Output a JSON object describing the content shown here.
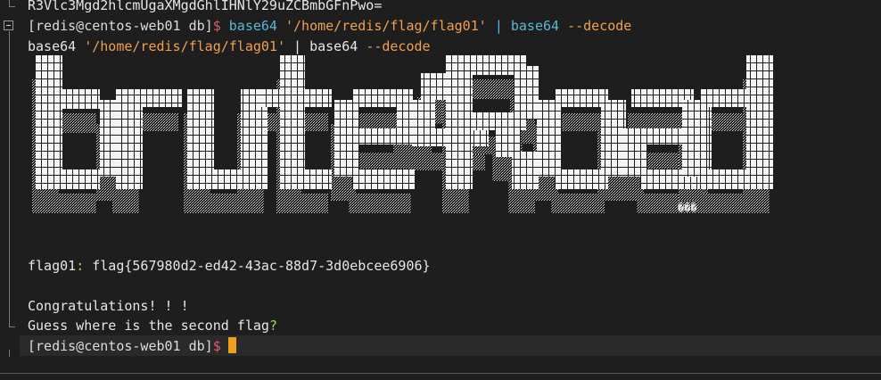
{
  "terminal": {
    "line0": "R3Vlc3Mgd2hlcmUgaXMgdGhlIHNlY29uZCBmbGFnPwo=",
    "prompt_text": "[redis@centos-web01 db]",
    "prompt_symbol": "$",
    "command": {
      "cmd1": "base64",
      "arg": "'/home/redis/flag/flag01'",
      "pipe": "|",
      "cmd2": "base64",
      "flag": "--decode"
    },
    "echo": {
      "cmd1": "base64",
      "arg": "'/home/redis/flag/flag01'",
      "pipe": "|",
      "cmd2": "base64",
      "flag": "--decode"
    },
    "banner_tail": "���",
    "flag_line": {
      "label": "flag01",
      "colon": ":",
      "prefix": "flag{",
      "value": "567980d2-ed42-43ac-88d7-3d0ebcee6906",
      "suffix": "}"
    },
    "congrats": "Congratulations! ! !",
    "question": "Guess where is the second flag",
    "question_mark": "?"
  },
  "colors": {
    "background": "#1e1e1e",
    "prompt_symbol": "#e05a70",
    "command": "#59b7d8",
    "string": "#f0a050",
    "cursor": "#f0a020"
  }
}
